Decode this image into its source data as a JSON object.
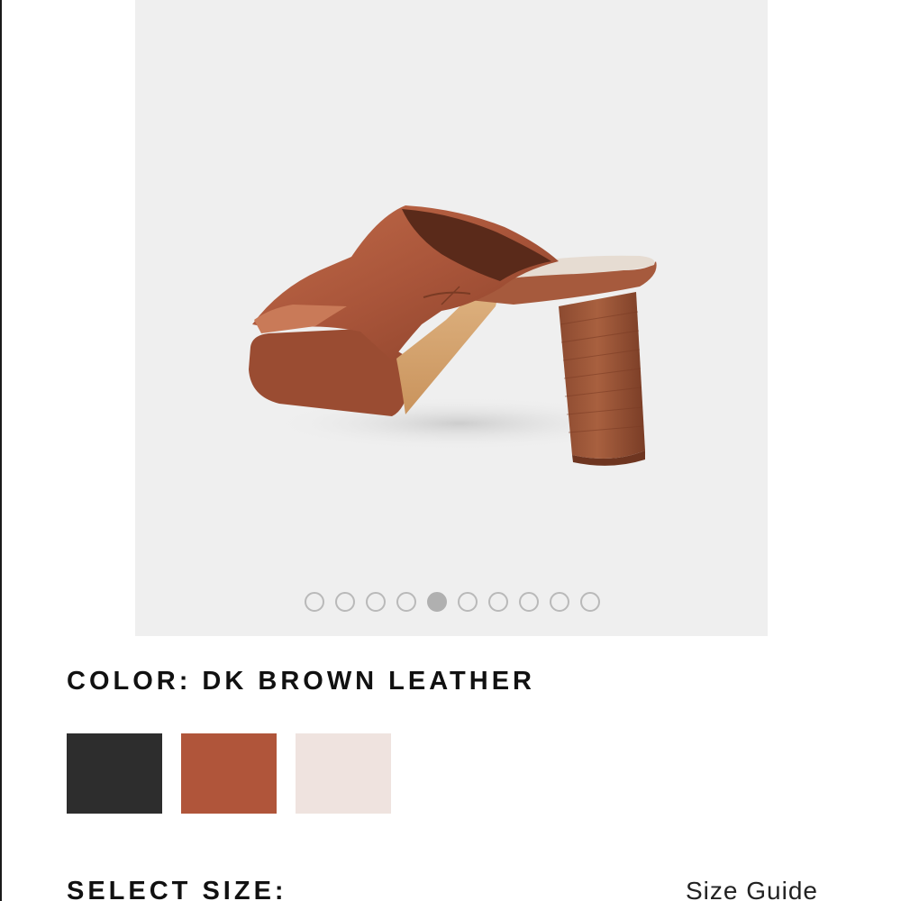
{
  "product": {
    "image_alt": "mule-sandal-product-image",
    "gallery": {
      "total_images": 10,
      "active_index": 4
    }
  },
  "color": {
    "label": "COLOR: DK BROWN LEATHER",
    "swatches": [
      {
        "name": "black",
        "hex": "#2d2d2d"
      },
      {
        "name": "dk-brown-leather",
        "hex": "#b0553a"
      },
      {
        "name": "ivory",
        "hex": "#efe3df"
      }
    ],
    "selected": "dk-brown-leather"
  },
  "size": {
    "label": "SELECT SIZE:",
    "guide_label": "Size Guide"
  }
}
